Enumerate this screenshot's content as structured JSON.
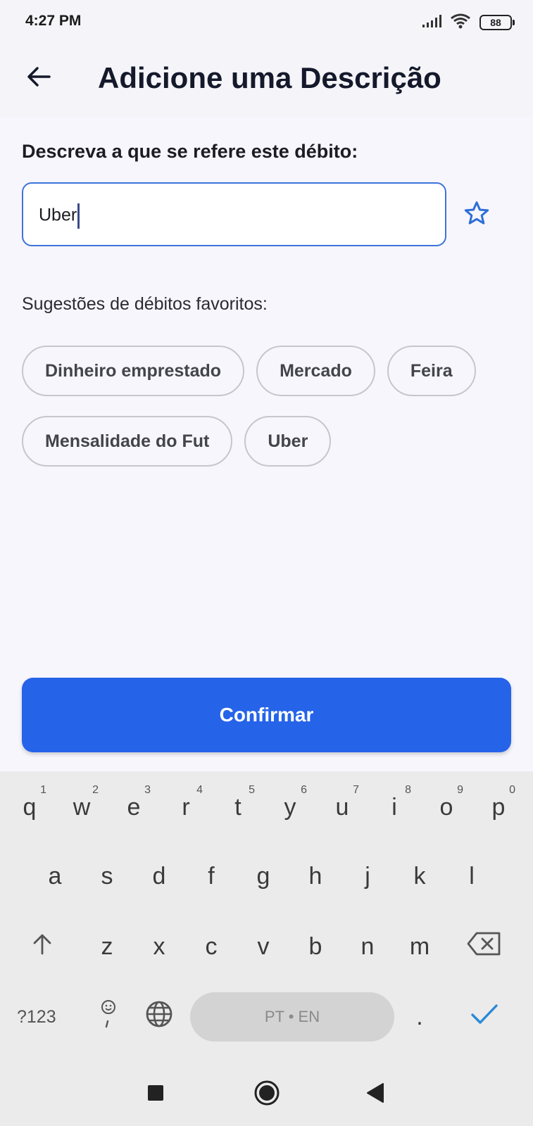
{
  "status_bar": {
    "time": "4:27 PM",
    "battery": "88"
  },
  "header": {
    "title": "Adicione uma Descrição"
  },
  "form": {
    "label": "Descreva a que se refere este débito:",
    "input_value": "Uber",
    "suggestions_label": "Sugestões de débitos favoritos:"
  },
  "suggestions": {
    "row1": [
      "Dinheiro emprestado",
      "Mercado",
      "Feira"
    ],
    "row2": [
      "Mensalidade do Fut",
      "Uber"
    ]
  },
  "confirm_label": "Confirmar",
  "keyboard": {
    "row1": [
      "q",
      "w",
      "e",
      "r",
      "t",
      "y",
      "u",
      "i",
      "o",
      "p"
    ],
    "row1_hints": [
      "1",
      "2",
      "3",
      "4",
      "5",
      "6",
      "7",
      "8",
      "9",
      "0"
    ],
    "row2": [
      "a",
      "s",
      "d",
      "f",
      "g",
      "h",
      "j",
      "k",
      "l"
    ],
    "row3": [
      "z",
      "x",
      "c",
      "v",
      "b",
      "n",
      "m"
    ],
    "symbols_label": "?123",
    "space_label": "PT • EN",
    "period": "."
  },
  "colors": {
    "accent": "#2563e9",
    "input_border": "#3d74d9"
  }
}
